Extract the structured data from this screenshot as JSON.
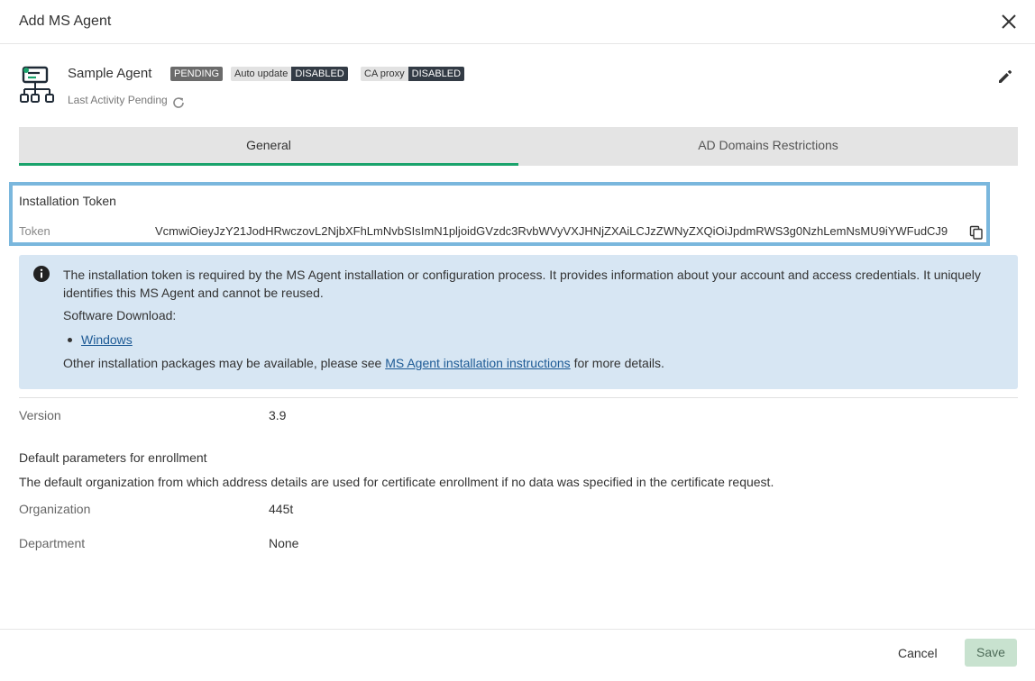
{
  "dialog": {
    "title": "Add MS Agent"
  },
  "agent": {
    "name": "Sample Agent",
    "status_badge": "PENDING",
    "auto_update": {
      "label": "Auto update",
      "value": "DISABLED"
    },
    "ca_proxy": {
      "label": "CA proxy",
      "value": "DISABLED"
    },
    "last_activity": "Last Activity Pending"
  },
  "tabs": [
    {
      "label": "General",
      "active": true
    },
    {
      "label": "AD Domains Restrictions",
      "active": false
    }
  ],
  "token": {
    "section_title": "Installation Token",
    "label": "Token",
    "value": "VcmwiOieyJzY21JodHRwczovL2NjbXFhLmNvbSIsImN1pljoidGVzdc3RvbWVyVXJHNjZXAiLCJzZWNyZXQiOiJpdmRWS3g0NzhLemNsMU9iYWFudCJ9"
  },
  "info": {
    "text": "The installation token is required by the MS Agent installation or configuration process. It provides information about your account and access credentials. It uniquely identifies this MS Agent and cannot be reused.",
    "download_label": "Software Download:",
    "downloads": [
      "Windows"
    ],
    "other_prefix": "Other installation packages may be available, please see",
    "other_link": "MS Agent installation instructions",
    "other_suffix": "for more details."
  },
  "details": {
    "version_label": "Version",
    "version_value": "3.9",
    "defaults_title": "Default parameters for enrollment",
    "defaults_desc": "The default organization from which address details are used for certificate enrollment if no data was specified in the certificate request.",
    "organization_label": "Organization",
    "organization_value": "445t",
    "department_label": "Department",
    "department_value": "None"
  },
  "footer": {
    "cancel_label": "Cancel",
    "save_label": "Save"
  },
  "colors": {
    "accent_green": "#1aa36c",
    "token_border": "#7ab7dd",
    "info_bg": "#d7e6f3",
    "link": "#1d5a95",
    "save_bg": "#c8e2cf"
  },
  "icons": {
    "close": "close-icon",
    "agent": "agent-network-icon",
    "refresh": "refresh-icon",
    "edit": "pencil-icon",
    "copy": "copy-icon",
    "info": "info-icon"
  }
}
